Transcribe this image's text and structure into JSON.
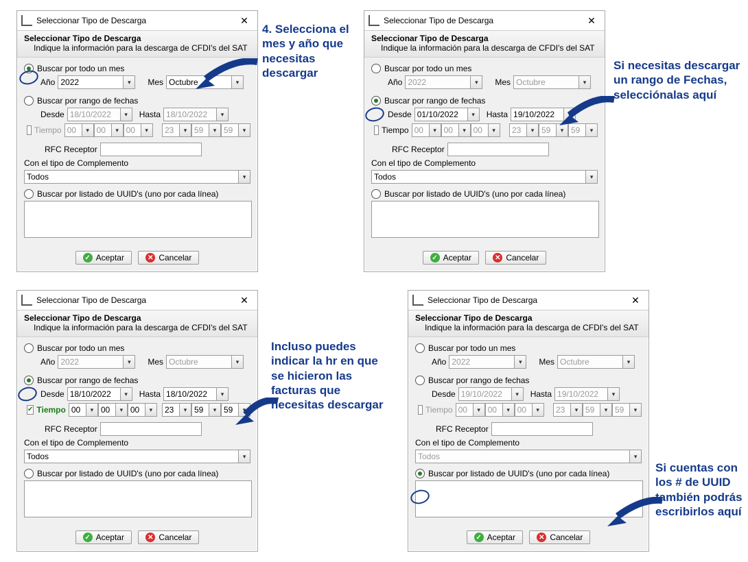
{
  "window": {
    "title": "Seleccionar Tipo de Descarga",
    "close": "✕",
    "section_title": "Seleccionar Tipo de Descarga",
    "section_desc": "Indique la información para la descarga de CFDI's del SAT"
  },
  "labels": {
    "buscar_mes": "Buscar por todo un mes",
    "anio": "Año",
    "mes": "Mes",
    "buscar_rango": "Buscar por rango de fechas",
    "desde": "Desde",
    "hasta": "Hasta",
    "tiempo": "Tiempo",
    "rfc": "RFC Receptor",
    "complemento": "Con el tipo de Complemento",
    "todos": "Todos",
    "buscar_uuid": "Buscar por listado de UUID's (uno por cada línea)",
    "aceptar": "Aceptar",
    "cancelar": "Cancelar"
  },
  "panel1": {
    "anio": "2022",
    "mes": "Octubre",
    "desde": "18/10/2022",
    "hasta": "18/10/2022",
    "t1": "00",
    "t2": "00",
    "t3": "00",
    "t4": "23",
    "t5": "59",
    "t6": "59"
  },
  "panel2": {
    "anio": "2022",
    "mes": "Octubre",
    "desde": "01/10/2022",
    "hasta": "19/10/2022",
    "t1": "00",
    "t2": "00",
    "t3": "00",
    "t4": "23",
    "t5": "59",
    "t6": "59"
  },
  "panel3": {
    "anio": "2022",
    "mes": "Octubre",
    "desde": "18/10/2022",
    "hasta": "18/10/2022",
    "t1": "00",
    "t2": "00",
    "t3": "00",
    "t4": "23",
    "t5": "59",
    "t6": "59"
  },
  "panel4": {
    "anio": "2022",
    "mes": "Octubre",
    "desde": "19/10/2022",
    "hasta": "19/10/2022",
    "t1": "00",
    "t2": "00",
    "t3": "00",
    "t4": "23",
    "t5": "59",
    "t6": "59"
  },
  "annotations": {
    "a1": "4. Selecciona el mes y año que necesitas descargar",
    "a2": "Si necesitas descargar un rango de Fechas, selecciónalas aquí",
    "a3": "Incluso puedes indicar la hr en que se hicieron las facturas que necesitas descargar",
    "a4": "Si cuentas con los # de UUID también podrás escribirlos aquí"
  }
}
